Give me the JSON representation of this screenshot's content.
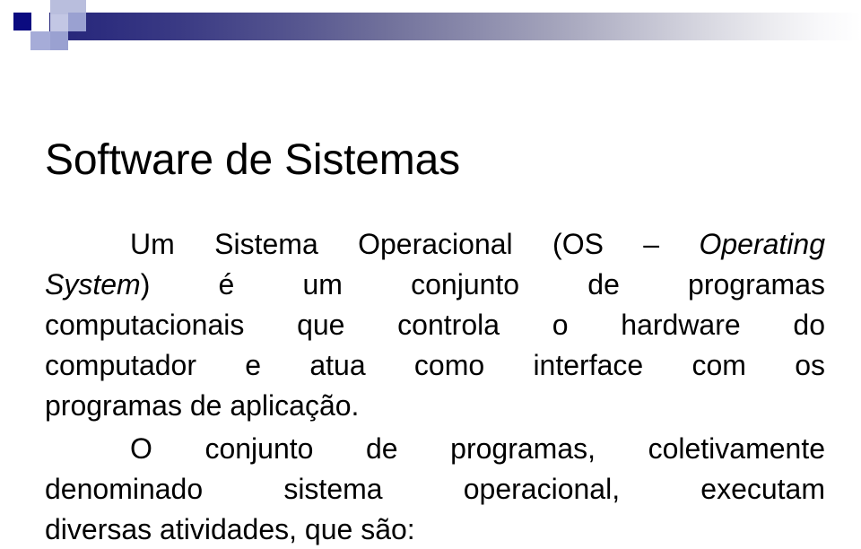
{
  "slide": {
    "title": "Software de Sistemas",
    "paragraphs": [
      {
        "id": "paragraph-1",
        "lines": [
          {
            "segments": [
              {
                "text": "Um Sistema Operacional (OS ",
                "style": "normal"
              },
              {
                "text": "–",
                "style": "normal"
              },
              {
                "text": " ",
                "style": "normal"
              },
              {
                "text": "Operating",
                "style": "italic"
              }
            ],
            "justified": true,
            "indent": true
          },
          {
            "segments": [
              {
                "text": "System",
                "style": "italic"
              },
              {
                "text": ") é um conjunto de programas",
                "style": "normal"
              }
            ],
            "justified": true,
            "indent": false
          },
          {
            "segments": [
              {
                "text": "computacionais que controla o hardware do",
                "style": "normal"
              }
            ],
            "justified": true,
            "indent": false
          },
          {
            "segments": [
              {
                "text": "computador e atua como interface com os",
                "style": "normal"
              }
            ],
            "justified": true,
            "indent": false
          },
          {
            "segments": [
              {
                "text": "programas de aplicação.",
                "style": "normal"
              }
            ],
            "justified": false,
            "indent": false
          }
        ]
      },
      {
        "id": "paragraph-2",
        "lines": [
          {
            "segments": [
              {
                "text": "O conjunto de programas, coletivamente",
                "style": "normal"
              }
            ],
            "justified": true,
            "indent": true
          },
          {
            "segments": [
              {
                "text": "denominado sistema operacional, executam",
                "style": "normal"
              }
            ],
            "justified": true,
            "indent": false
          },
          {
            "segments": [
              {
                "text": "diversas atividades, que são:",
                "style": "normal"
              }
            ],
            "justified": false,
            "indent": false
          }
        ]
      }
    ],
    "plain_text": {
      "paragraph_1": "Um Sistema Operacional (OS – Operating System) é um conjunto de programas computacionais que controla o hardware do computador e atua como interface com os programas de aplicação.",
      "paragraph_2": "O conjunto de programas, coletivamente denominado sistema operacional, executam diversas atividades, que são:"
    }
  },
  "decoration": {
    "name": "powerpoint-header-ornament",
    "gradient_start_color": "#26267a",
    "gradient_end_color": "#ffffff",
    "accent_navy": "#0b0b80",
    "accent_lavender": "#9aa1d1",
    "accent_pale_lavender": "#b9bedd",
    "accent_light": "#c3c7e4"
  },
  "theme": {
    "background_color": "#ffffff",
    "text_color": "#000000",
    "title_color": "#000000"
  }
}
